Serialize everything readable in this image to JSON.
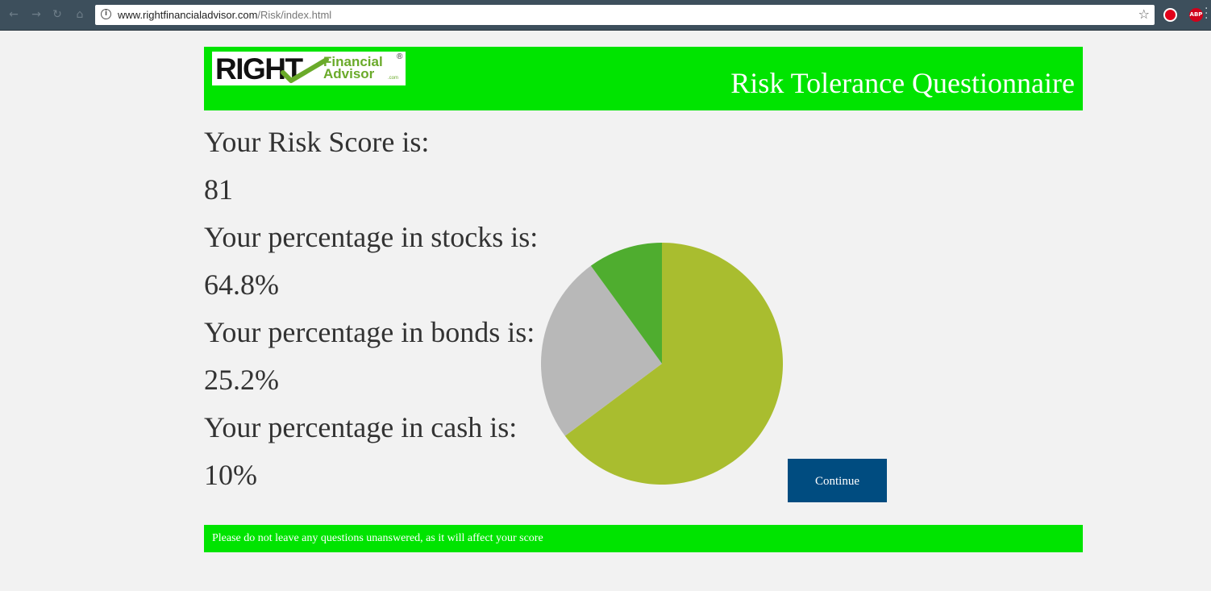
{
  "browser": {
    "url_host": "www.rightfinancialadvisor.com",
    "url_path": "/Risk/index.html",
    "icons": [
      "back-icon",
      "forward-icon",
      "reload-icon",
      "home-icon",
      "info-icon",
      "star-icon",
      "adblock-icon",
      "abp-icon",
      "menu-icon"
    ],
    "abp_label": "ABP"
  },
  "header": {
    "logo_right": "RIGHT",
    "logo_financial": "Financial",
    "logo_advisor": "Advisor",
    "logo_dotcom": ".com",
    "logo_registered": "®",
    "title": "Risk Tolerance Questionnaire",
    "background_color": "#00e400"
  },
  "results": {
    "score_label": "Your Risk Score is:",
    "score_value": "81",
    "stocks_label": "Your percentage in stocks is:",
    "stocks_value": "64.8%",
    "bonds_label": "Your percentage in bonds is:",
    "bonds_value": "25.2%",
    "cash_label": "Your percentage in cash is:",
    "cash_value": "10%"
  },
  "chart_data": {
    "type": "pie",
    "slices": [
      {
        "label": "stocks",
        "value": 64.8,
        "color": "#a9bd2f"
      },
      {
        "label": "bonds",
        "value": 25.2,
        "color": "#b8b8b8"
      },
      {
        "label": "cash",
        "value": 10,
        "color": "#4fad2f"
      }
    ],
    "start_angle": "12 o'clock",
    "direction": "clockwise"
  },
  "continue_button": {
    "label": "Continue",
    "color": "#004c80"
  },
  "footer": {
    "note": "Please do not leave any questions unanswered, as it will affect your score"
  }
}
